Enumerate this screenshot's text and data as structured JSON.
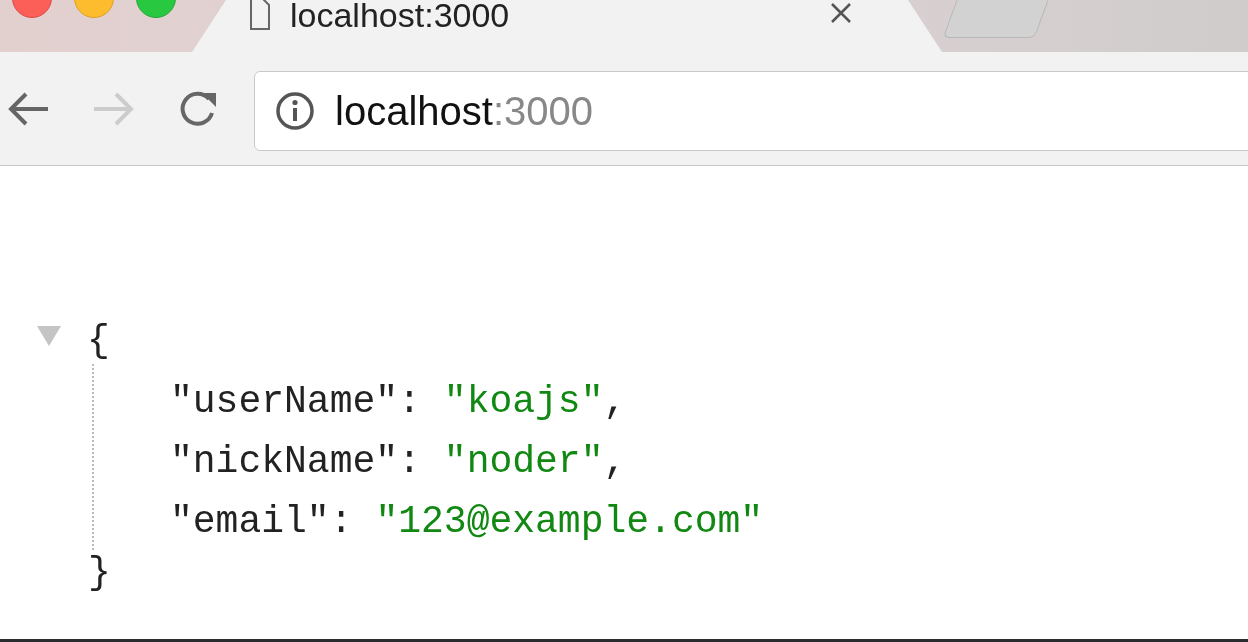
{
  "tab": {
    "title": "localhost:3000",
    "selected": true
  },
  "toolbar": {
    "back_disabled": false,
    "forward_disabled": true
  },
  "address_bar": {
    "host": "localhost",
    "port": ":3000"
  },
  "json_viewer": {
    "expanded": true,
    "open": "{",
    "close": "}",
    "entries": [
      {
        "key": "\"userName\"",
        "colon": ":",
        "value": "\"koajs\"",
        "comma": ","
      },
      {
        "key": "\"nickName\"",
        "colon": ":",
        "value": "\"noder\"",
        "comma": ","
      },
      {
        "key": "\"email\"",
        "colon": ":",
        "value": "\"123@example.com\""
      }
    ]
  }
}
